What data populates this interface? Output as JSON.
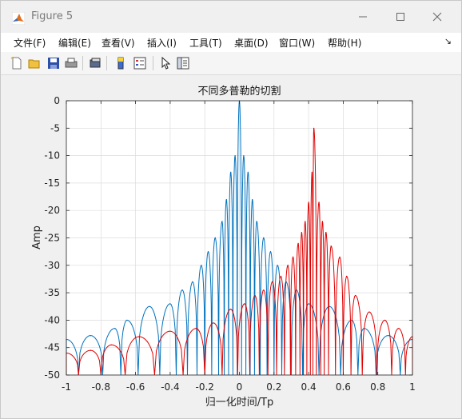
{
  "window": {
    "title": "Figure 5",
    "minimize_label": "minimize",
    "maximize_label": "maximize",
    "close_label": "close"
  },
  "menu": {
    "items": [
      "文件(F)",
      "编辑(E)",
      "查看(V)",
      "插入(I)",
      "工具(T)",
      "桌面(D)",
      "窗口(W)",
      "帮助(H)"
    ]
  },
  "toolbar": {
    "icons": [
      "new-figure-icon",
      "open-file-icon",
      "save-icon",
      "print-icon",
      "link-plot-icon",
      "colorbar-icon",
      "legend-icon",
      "pointer-icon",
      "property-inspector-icon"
    ]
  },
  "chart_data": {
    "type": "line",
    "title": "不同多普勒的切割",
    "xlabel": "归一化时间/Tp",
    "ylabel": "Amp",
    "xlim": [
      -1,
      1
    ],
    "ylim": [
      -50,
      0
    ],
    "xticks": [
      "-1",
      "-0.8",
      "-0.6",
      "-0.4",
      "-0.2",
      "0",
      "0.2",
      "0.4",
      "0.6",
      "0.8",
      "1"
    ],
    "yticks": [
      "0",
      "-5",
      "-10",
      "-15",
      "-20",
      "-25",
      "-30",
      "-35",
      "-40",
      "-45",
      "-50"
    ],
    "grid": true,
    "series": [
      {
        "color": "#0072bd",
        "peaks": [
          {
            "x": -1.0,
            "y": -43.5
          },
          {
            "x": -0.86,
            "y": -42.8
          },
          {
            "x": -0.72,
            "y": -41.5
          },
          {
            "x": -0.65,
            "y": -40.0
          },
          {
            "x": -0.52,
            "y": -37.5
          },
          {
            "x": -0.4,
            "y": -37.0
          },
          {
            "x": -0.33,
            "y": -34.5
          },
          {
            "x": -0.27,
            "y": -33.0
          },
          {
            "x": -0.22,
            "y": -30.0
          },
          {
            "x": -0.18,
            "y": -27.5
          },
          {
            "x": -0.14,
            "y": -25.0
          },
          {
            "x": -0.1,
            "y": -22.0
          },
          {
            "x": -0.075,
            "y": -18.0
          },
          {
            "x": -0.05,
            "y": -13.0
          },
          {
            "x": -0.025,
            "y": -10.0
          },
          {
            "x": 0.0,
            "y": 0.0
          },
          {
            "x": 0.025,
            "y": -10.0
          },
          {
            "x": 0.05,
            "y": -13.0
          },
          {
            "x": 0.075,
            "y": -18.0
          },
          {
            "x": 0.1,
            "y": -22.0
          },
          {
            "x": 0.14,
            "y": -25.0
          },
          {
            "x": 0.18,
            "y": -27.5
          },
          {
            "x": 0.22,
            "y": -30.0
          },
          {
            "x": 0.27,
            "y": -33.0
          },
          {
            "x": 0.33,
            "y": -34.5
          },
          {
            "x": 0.4,
            "y": -37.0
          },
          {
            "x": 0.52,
            "y": -37.5
          },
          {
            "x": 0.65,
            "y": -40.0
          },
          {
            "x": 0.72,
            "y": -41.5
          },
          {
            "x": 0.86,
            "y": -42.8
          },
          {
            "x": 1.0,
            "y": -43.5
          }
        ]
      },
      {
        "color": "#e00000",
        "peaks": [
          {
            "x": -1.0,
            "y": -46.0
          },
          {
            "x": -0.86,
            "y": -45.5
          },
          {
            "x": -0.74,
            "y": -44.5
          },
          {
            "x": -0.58,
            "y": -43.0
          },
          {
            "x": -0.4,
            "y": -42.0
          },
          {
            "x": -0.25,
            "y": -41.5
          },
          {
            "x": -0.15,
            "y": -40.5
          },
          {
            "x": -0.05,
            "y": -38.0
          },
          {
            "x": 0.03,
            "y": -37.0
          },
          {
            "x": 0.09,
            "y": -35.5
          },
          {
            "x": 0.14,
            "y": -34.5
          },
          {
            "x": 0.19,
            "y": -33.0
          },
          {
            "x": 0.24,
            "y": -32.0
          },
          {
            "x": 0.28,
            "y": -30.0
          },
          {
            "x": 0.31,
            "y": -28.5
          },
          {
            "x": 0.34,
            "y": -26.0
          },
          {
            "x": 0.36,
            "y": -24.0
          },
          {
            "x": 0.38,
            "y": -22.0
          },
          {
            "x": 0.4,
            "y": -18.5
          },
          {
            "x": 0.42,
            "y": -13.0
          },
          {
            "x": 0.43,
            "y": -5.0
          },
          {
            "x": 0.46,
            "y": -18.5
          },
          {
            "x": 0.48,
            "y": -22.0
          },
          {
            "x": 0.5,
            "y": -24.0
          },
          {
            "x": 0.53,
            "y": -26.5
          },
          {
            "x": 0.58,
            "y": -28.5
          },
          {
            "x": 0.62,
            "y": -32.0
          },
          {
            "x": 0.67,
            "y": -35.5
          },
          {
            "x": 0.75,
            "y": -38.5
          },
          {
            "x": 0.84,
            "y": -40.0
          },
          {
            "x": 0.92,
            "y": -41.5
          },
          {
            "x": 1.0,
            "y": -43.0
          }
        ]
      }
    ]
  }
}
